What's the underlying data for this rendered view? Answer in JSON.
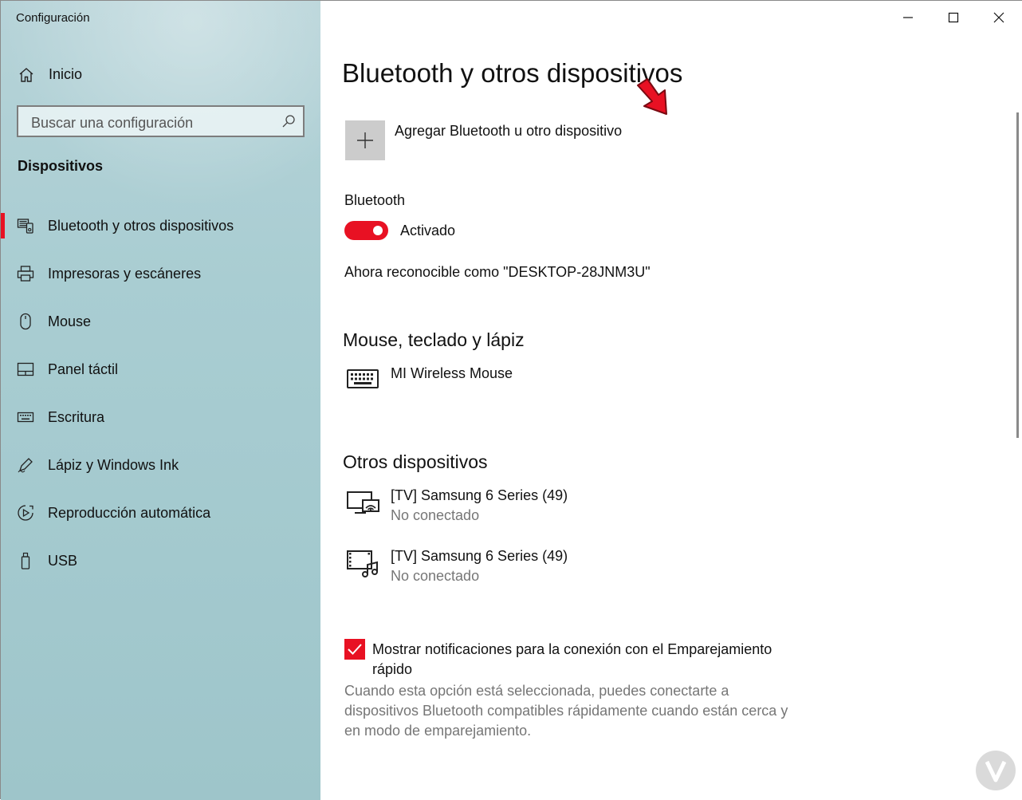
{
  "window": {
    "title": "Configuración"
  },
  "sidebar": {
    "home_label": "Inicio",
    "search_placeholder": "Buscar una configuración",
    "section_title": "Dispositivos",
    "items": [
      {
        "label": "Bluetooth y otros dispositivos",
        "icon": "bluetooth-devices-icon",
        "active": true
      },
      {
        "label": "Impresoras y escáneres",
        "icon": "printer-icon",
        "active": false
      },
      {
        "label": "Mouse",
        "icon": "mouse-icon",
        "active": false
      },
      {
        "label": "Panel táctil",
        "icon": "touchpad-icon",
        "active": false
      },
      {
        "label": "Escritura",
        "icon": "keyboard-icon",
        "active": false
      },
      {
        "label": "Lápiz y Windows Ink",
        "icon": "pen-icon",
        "active": false
      },
      {
        "label": "Reproducción automática",
        "icon": "autoplay-icon",
        "active": false
      },
      {
        "label": "USB",
        "icon": "usb-icon",
        "active": false
      }
    ]
  },
  "main": {
    "title": "Bluetooth y otros dispositivos",
    "add_device_label": "Agregar Bluetooth u otro dispositivo",
    "bluetooth": {
      "label": "Bluetooth",
      "state_label": "Activado",
      "enabled": true,
      "discoverable_text": "Ahora reconocible como \"DESKTOP-28JNM3U\""
    },
    "groups": [
      {
        "title": "Mouse, teclado y lápiz",
        "devices": [
          {
            "name": "MI Wireless Mouse",
            "status": "",
            "icon": "keyboard-icon"
          }
        ]
      },
      {
        "title": "Otros dispositivos",
        "devices": [
          {
            "name": "[TV] Samsung 6 Series (49)",
            "status": "No conectado",
            "icon": "display-wireless-icon"
          },
          {
            "name": "[TV] Samsung 6 Series (49)",
            "status": "No conectado",
            "icon": "media-device-icon"
          }
        ]
      }
    ],
    "swift_pair": {
      "checked": true,
      "label": "Mostrar notificaciones para la conexión con el Emparejamiento rápido",
      "description": "Cuando esta opción está seleccionada, puedes conectarte a dispositivos Bluetooth compatibles rápidamente cuando están cerca y en modo de emparejamiento."
    }
  },
  "colors": {
    "accent": "#e81123",
    "sidebar_bg": "#a9cdd2",
    "secondary_text": "#767676"
  }
}
